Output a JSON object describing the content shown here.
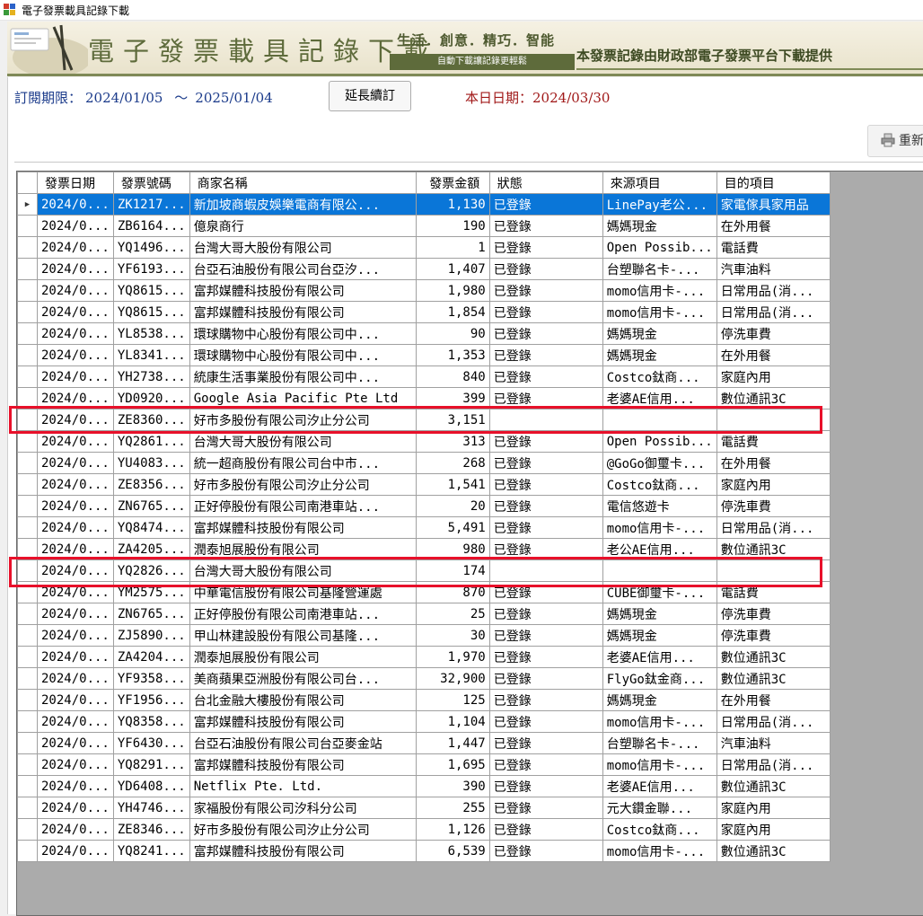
{
  "window": {
    "title": "電子發票載具記錄下載"
  },
  "banner": {
    "title": "電子發票載具記錄下載",
    "slogan": "生活．創意．精巧．智能",
    "tagline": "自動下載讓記錄更輕鬆",
    "source": "本發票記錄由財政部電子發票平台下載提供"
  },
  "subscription": {
    "label": "訂閱期限：",
    "start": "2024/01/05",
    "separator": "～",
    "end": "2025/01/04"
  },
  "extend_button": "延長續訂",
  "today": {
    "label": "本日日期：",
    "value": "2024/03/30"
  },
  "refresh_button": "重新",
  "grid": {
    "columns": [
      "發票日期",
      "發票號碼",
      "商家名稱",
      "發票金額",
      "狀態",
      "來源項目",
      "目的項目"
    ],
    "rows": [
      {
        "date": "2024/0...",
        "no": "ZK1217...",
        "merchant": "新加坡商蝦皮娛樂電商有限公...",
        "amount": "1,130",
        "status": "已登錄",
        "source": "LinePay老公...",
        "target": "家電傢具家用品"
      },
      {
        "date": "2024/0...",
        "no": "ZB6164...",
        "merchant": "億泉商行",
        "amount": "190",
        "status": "已登錄",
        "source": "媽媽現金",
        "target": "在外用餐"
      },
      {
        "date": "2024/0...",
        "no": "YQ1496...",
        "merchant": "台灣大哥大股份有限公司",
        "amount": "1",
        "status": "已登錄",
        "source": "Open Possib...",
        "target": "電話費"
      },
      {
        "date": "2024/0...",
        "no": "YF6193...",
        "merchant": "台亞石油股份有限公司台亞汐...",
        "amount": "1,407",
        "status": "已登錄",
        "source": "台塑聯名卡-...",
        "target": "汽車油料"
      },
      {
        "date": "2024/0...",
        "no": "YQ8615...",
        "merchant": "富邦媒體科技股份有限公司",
        "amount": "1,980",
        "status": "已登錄",
        "source": "momo信用卡-...",
        "target": "日常用品(消..."
      },
      {
        "date": "2024/0...",
        "no": "YQ8615...",
        "merchant": "富邦媒體科技股份有限公司",
        "amount": "1,854",
        "status": "已登錄",
        "source": "momo信用卡-...",
        "target": "日常用品(消..."
      },
      {
        "date": "2024/0...",
        "no": "YL8538...",
        "merchant": "環球購物中心股份有限公司中...",
        "amount": "90",
        "status": "已登錄",
        "source": "媽媽現金",
        "target": "停洗車費"
      },
      {
        "date": "2024/0...",
        "no": "YL8341...",
        "merchant": "環球購物中心股份有限公司中...",
        "amount": "1,353",
        "status": "已登錄",
        "source": "媽媽現金",
        "target": "在外用餐"
      },
      {
        "date": "2024/0...",
        "no": "YH2738...",
        "merchant": "統康生活事業股份有限公司中...",
        "amount": "840",
        "status": "已登錄",
        "source": "Costco鈦商...",
        "target": "家庭內用"
      },
      {
        "date": "2024/0...",
        "no": "YD0920...",
        "merchant": "Google Asia Pacific Pte Ltd",
        "amount": "399",
        "status": "已登錄",
        "source": "老婆AE信用...",
        "target": "數位通訊3C"
      },
      {
        "date": "2024/0...",
        "no": "ZE8360...",
        "merchant": "好市多股份有限公司汐止分公司",
        "amount": "3,151",
        "status": "",
        "source": "",
        "target": ""
      },
      {
        "date": "2024/0...",
        "no": "YQ2861...",
        "merchant": "台灣大哥大股份有限公司",
        "amount": "313",
        "status": "已登錄",
        "source": "Open Possib...",
        "target": "電話費"
      },
      {
        "date": "2024/0...",
        "no": "YU4083...",
        "merchant": "統一超商股份有限公司台中市...",
        "amount": "268",
        "status": "已登錄",
        "source": "@GoGo御璽卡...",
        "target": "在外用餐"
      },
      {
        "date": "2024/0...",
        "no": "ZE8356...",
        "merchant": "好市多股份有限公司汐止分公司",
        "amount": "1,541",
        "status": "已登錄",
        "source": "Costco鈦商...",
        "target": "家庭內用"
      },
      {
        "date": "2024/0...",
        "no": "ZN6765...",
        "merchant": "正好停股份有限公司南港車站...",
        "amount": "20",
        "status": "已登錄",
        "source": "電信悠遊卡",
        "target": "停洗車費"
      },
      {
        "date": "2024/0...",
        "no": "YQ8474...",
        "merchant": "富邦媒體科技股份有限公司",
        "amount": "5,491",
        "status": "已登錄",
        "source": "momo信用卡-...",
        "target": "日常用品(消..."
      },
      {
        "date": "2024/0...",
        "no": "ZA4205...",
        "merchant": "潤泰旭展股份有限公司",
        "amount": "980",
        "status": "已登錄",
        "source": "老公AE信用...",
        "target": "數位通訊3C"
      },
      {
        "date": "2024/0...",
        "no": "YQ2826...",
        "merchant": "台灣大哥大股份有限公司",
        "amount": "174",
        "status": "",
        "source": "",
        "target": ""
      },
      {
        "date": "2024/0...",
        "no": "YM2575...",
        "merchant": "中華電信股份有限公司基隆營運處",
        "amount": "870",
        "status": "已登錄",
        "source": "CUBE御璽卡-...",
        "target": "電話費"
      },
      {
        "date": "2024/0...",
        "no": "ZN6765...",
        "merchant": "正好停股份有限公司南港車站...",
        "amount": "25",
        "status": "已登錄",
        "source": "媽媽現金",
        "target": "停洗車費"
      },
      {
        "date": "2024/0...",
        "no": "ZJ5890...",
        "merchant": "甲山林建設股份有限公司基隆...",
        "amount": "30",
        "status": "已登錄",
        "source": "媽媽現金",
        "target": "停洗車費"
      },
      {
        "date": "2024/0...",
        "no": "ZA4204...",
        "merchant": "潤泰旭展股份有限公司",
        "amount": "1,970",
        "status": "已登錄",
        "source": "老婆AE信用...",
        "target": "數位通訊3C"
      },
      {
        "date": "2024/0...",
        "no": "YF9358...",
        "merchant": "美商蘋果亞洲股份有限公司台...",
        "amount": "32,900",
        "status": "已登錄",
        "source": "FlyGo鈦金商...",
        "target": "數位通訊3C"
      },
      {
        "date": "2024/0...",
        "no": "YF1956...",
        "merchant": "台北金融大樓股份有限公司",
        "amount": "125",
        "status": "已登錄",
        "source": "媽媽現金",
        "target": "在外用餐"
      },
      {
        "date": "2024/0...",
        "no": "YQ8358...",
        "merchant": "富邦媒體科技股份有限公司",
        "amount": "1,104",
        "status": "已登錄",
        "source": "momo信用卡-...",
        "target": "日常用品(消..."
      },
      {
        "date": "2024/0...",
        "no": "YF6430...",
        "merchant": "台亞石油股份有限公司台亞麥金站",
        "amount": "1,447",
        "status": "已登錄",
        "source": "台塑聯名卡-...",
        "target": "汽車油料"
      },
      {
        "date": "2024/0...",
        "no": "YQ8291...",
        "merchant": "富邦媒體科技股份有限公司",
        "amount": "1,695",
        "status": "已登錄",
        "source": "momo信用卡-...",
        "target": "日常用品(消..."
      },
      {
        "date": "2024/0...",
        "no": "YD6408...",
        "merchant": "Netflix Pte. Ltd.",
        "amount": "390",
        "status": "已登錄",
        "source": "老婆AE信用...",
        "target": "數位通訊3C"
      },
      {
        "date": "2024/0...",
        "no": "YH4746...",
        "merchant": "家福股份有限公司汐科分公司",
        "amount": "255",
        "status": "已登錄",
        "source": "元大鑽金聯...",
        "target": "家庭內用"
      },
      {
        "date": "2024/0...",
        "no": "ZE8346...",
        "merchant": "好市多股份有限公司汐止分公司",
        "amount": "1,126",
        "status": "已登錄",
        "source": "Costco鈦商...",
        "target": "家庭內用"
      },
      {
        "date": "2024/0...",
        "no": "YQ8241...",
        "merchant": "富邦媒體科技股份有限公司",
        "amount": "6,539",
        "status": "已登錄",
        "source": "momo信用卡-...",
        "target": "數位通訊3C"
      }
    ]
  },
  "colors": {
    "selection": "#0a76d8",
    "highlight": "#e8102a",
    "banner_green": "#5e6b3b",
    "date_blue": "#1a3a8a",
    "today_red": "#a01818"
  }
}
